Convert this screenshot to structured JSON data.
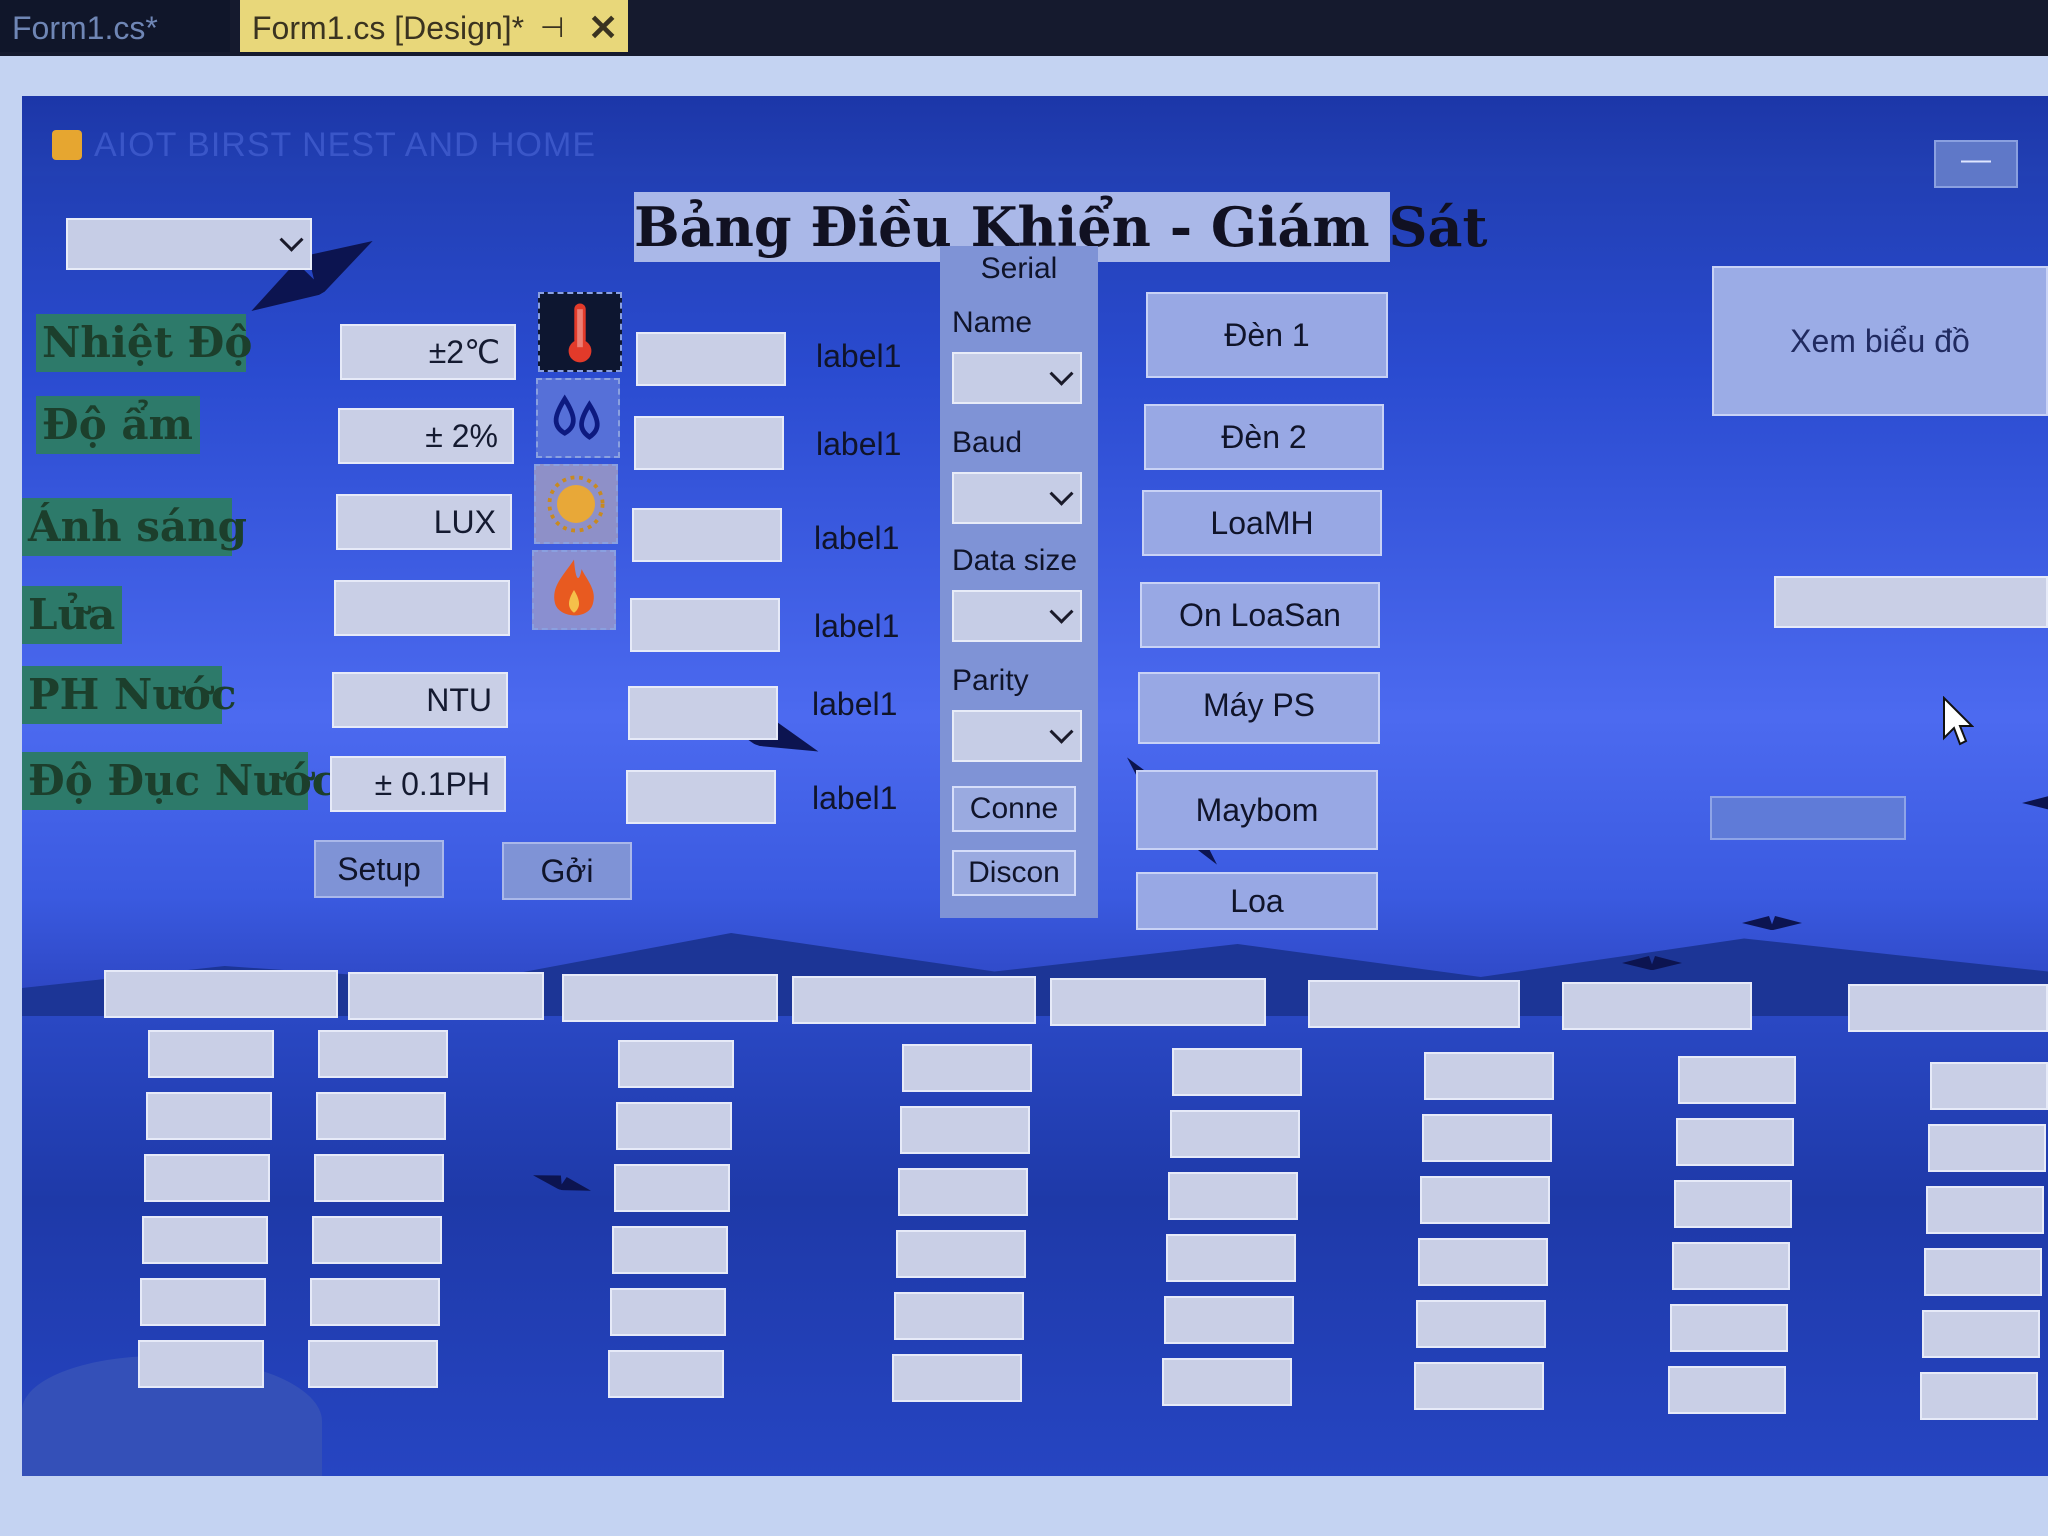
{
  "ide": {
    "tabs": [
      {
        "label": "Form1.cs*",
        "active": false
      },
      {
        "label": "Form1.cs [Design]*",
        "active": true
      }
    ],
    "pin_glyph": "⊣",
    "close_glyph": "✕"
  },
  "form": {
    "title": "AIOT BIRST NEST AND HOME",
    "minimize_glyph": "—",
    "heading": "Bảng Điều Khiển - Giám Sát",
    "top_combo_value": "",
    "sensors": [
      {
        "label": "Nhiệt Độ",
        "unit": "±2℃",
        "icon": "thermometer-icon",
        "value": "",
        "status": "label1"
      },
      {
        "label": "Độ ẩm",
        "unit": "± 2%",
        "icon": "humidity-drops-icon",
        "value": "",
        "status": "label1"
      },
      {
        "label": "Ánh sáng",
        "unit": "LUX",
        "icon": "sun-icon",
        "value": "",
        "status": "label1"
      },
      {
        "label": "Lửa",
        "unit": "",
        "icon": "fire-icon",
        "value": "",
        "status": "label1"
      },
      {
        "label": "PH Nước",
        "unit": "NTU",
        "icon": "",
        "value": "",
        "status": "label1"
      },
      {
        "label": "Độ Đục Nước",
        "unit": "± 0.1PH",
        "icon": "",
        "value": "",
        "status": "label1"
      }
    ],
    "buttons": {
      "setup": "Setup",
      "send": "Gởi"
    },
    "serial": {
      "title": "Serial",
      "fields": [
        {
          "label": "Name",
          "value": ""
        },
        {
          "label": "Baud",
          "value": ""
        },
        {
          "label": "Data size",
          "value": ""
        },
        {
          "label": "Parity",
          "value": ""
        }
      ],
      "connect": "Conne",
      "disconnect": "Discon"
    },
    "controls": [
      "Đèn 1",
      "Đèn 2",
      "LoaMH",
      "On LoaSan",
      "Máy PS",
      "Maybom",
      "Loa"
    ],
    "chart_button": "Xem biểu đồ",
    "right_inputs": [
      "",
      ""
    ],
    "grid": {
      "columns": 8,
      "rows": 6
    }
  }
}
